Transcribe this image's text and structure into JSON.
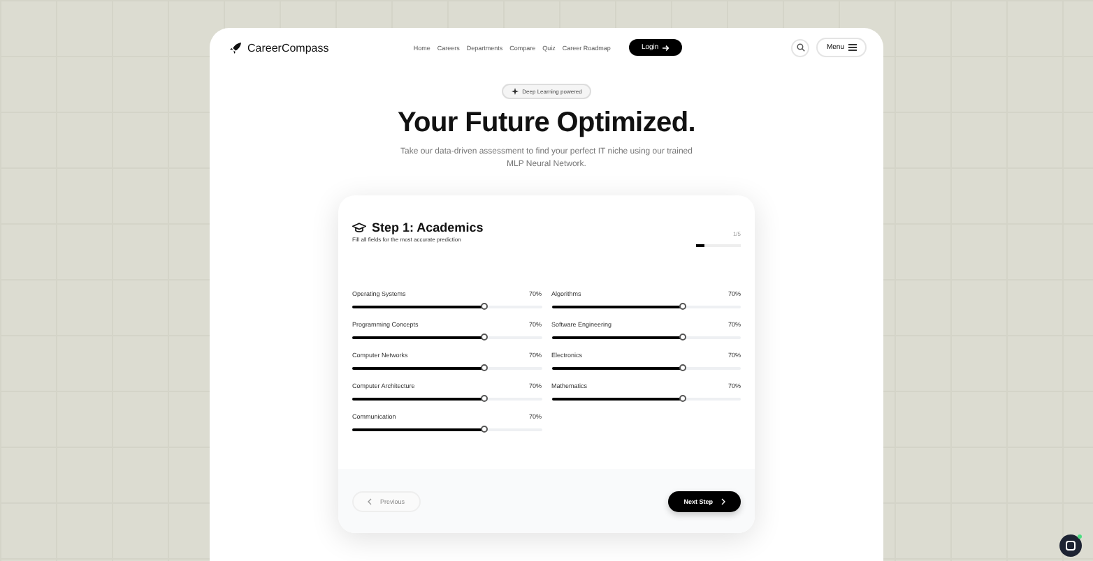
{
  "brand": {
    "name": "CareerCompass"
  },
  "nav": [
    {
      "label": "Home"
    },
    {
      "label": "Careers"
    },
    {
      "label": "Departments"
    },
    {
      "label": "Compare"
    },
    {
      "label": "Quiz"
    },
    {
      "label": "Career Roadmap"
    }
  ],
  "login": {
    "label": "Login"
  },
  "menu": {
    "label": "Menu"
  },
  "hero": {
    "badge": "Deep Learning powered",
    "title": "Your Future Optimized.",
    "subtitle": "Take our data-driven assessment to find your perfect IT niche using our trained MLP Neural Network."
  },
  "step": {
    "title": "Step 1: Academics",
    "subtitle": "Fill all fields for the most accurate prediction",
    "counter": "1/5",
    "level": 0.2
  },
  "subjects": [
    {
      "name": "Operating Systems",
      "reading": "70%",
      "level": 0.7
    },
    {
      "name": "Algorithms",
      "reading": "70%",
      "level": 0.7
    },
    {
      "name": "Programming Concepts",
      "reading": "70%",
      "level": 0.7
    },
    {
      "name": "Software Engineering",
      "reading": "70%",
      "level": 0.7
    },
    {
      "name": "Computer Networks",
      "reading": "70%",
      "level": 0.7
    },
    {
      "name": "Electronics",
      "reading": "70%",
      "level": 0.7
    },
    {
      "name": "Computer Architecture",
      "reading": "70%",
      "level": 0.7
    },
    {
      "name": "Mathematics",
      "reading": "70%",
      "level": 0.7
    },
    {
      "name": "Communication",
      "reading": "70%",
      "level": 0.7
    }
  ],
  "buttons": {
    "previous": "Previous",
    "next": "Next Step"
  }
}
